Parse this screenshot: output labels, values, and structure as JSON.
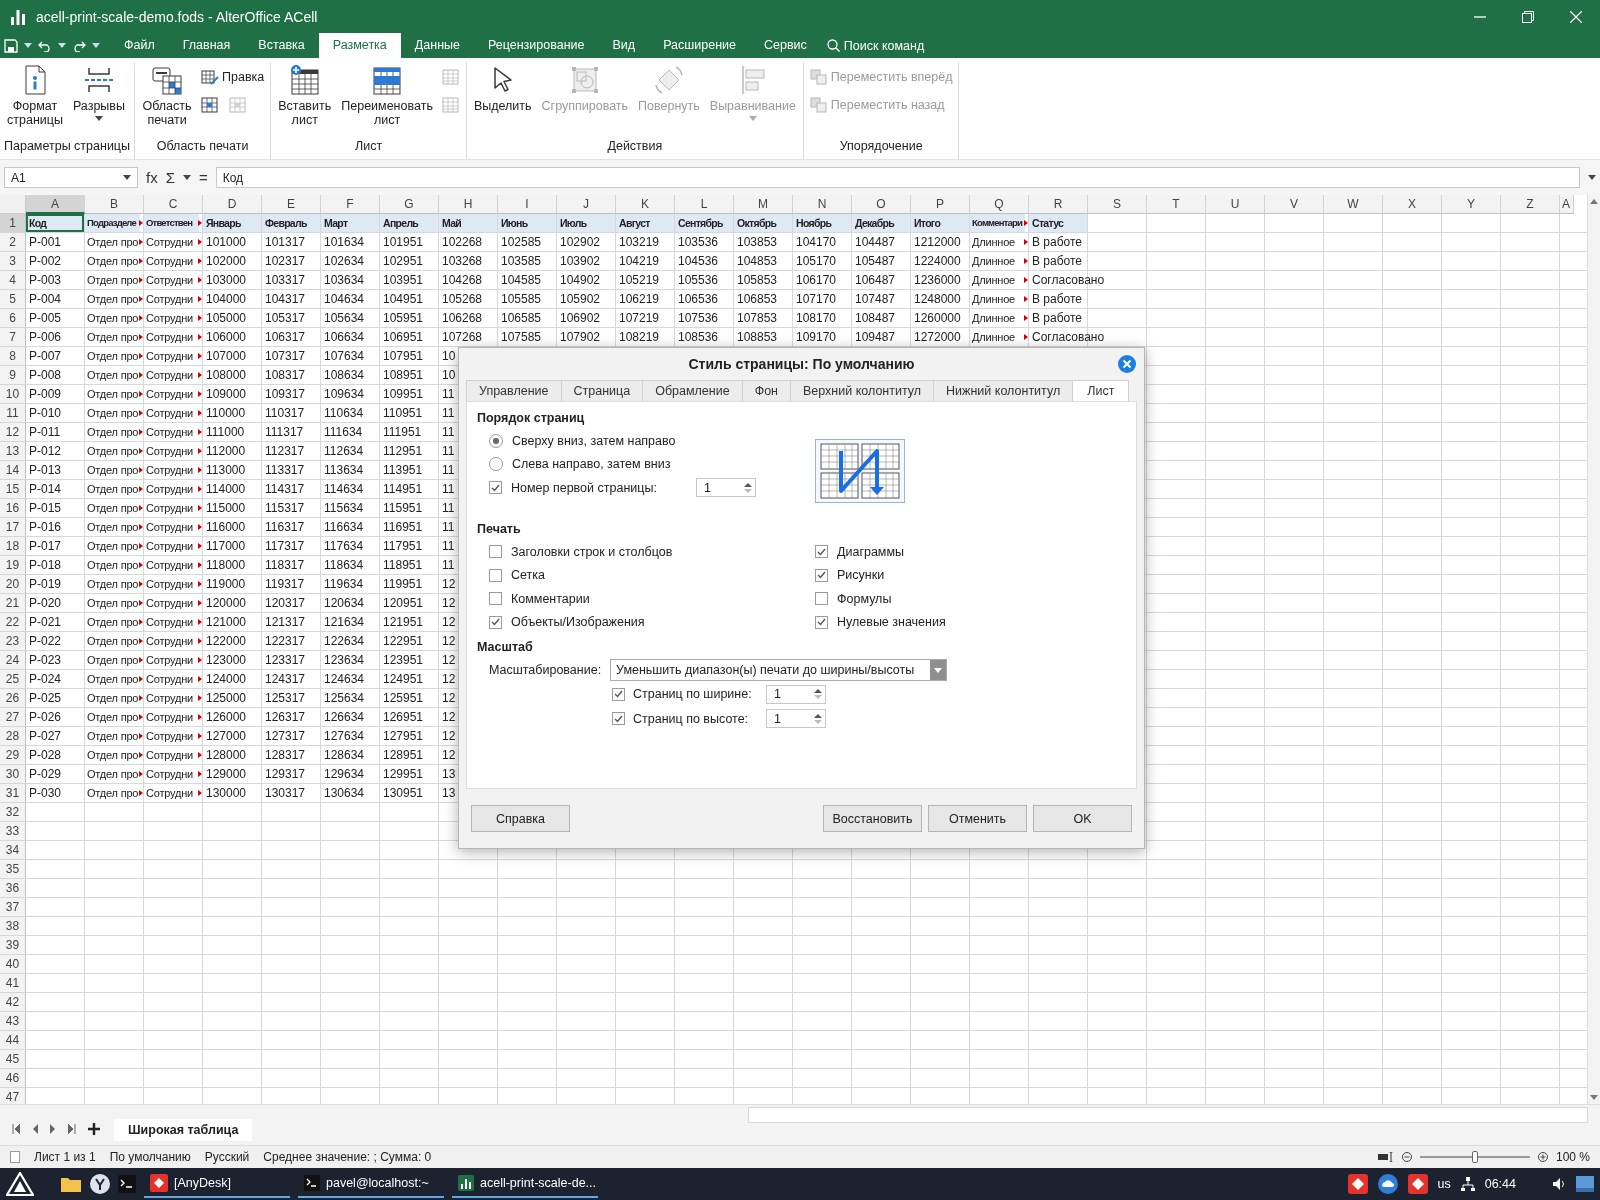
{
  "window": {
    "title": "acell-print-scale-demo.fods - AlterOffice ACell"
  },
  "menu": [
    {
      "label": "Файл",
      "selected": false
    },
    {
      "label": "Главная",
      "selected": false
    },
    {
      "label": "Вставка",
      "selected": false
    },
    {
      "label": "Разметка",
      "selected": true
    },
    {
      "label": "Данные",
      "selected": false
    },
    {
      "label": "Рецензирование",
      "selected": false
    },
    {
      "label": "Вид",
      "selected": false
    },
    {
      "label": "Расширение",
      "selected": false
    },
    {
      "label": "Сервис",
      "selected": false
    }
  ],
  "search": {
    "label": "Поиск команд"
  },
  "ribbon": {
    "groups": [
      {
        "label": "Параметры страницы",
        "buttons": [
          {
            "kind": "large",
            "label": "Формат\nстраницы",
            "disabled": false,
            "dropdown": false
          },
          {
            "kind": "large",
            "label": "Разрывы",
            "disabled": false,
            "dropdown": true
          }
        ]
      },
      {
        "label": "Область печати",
        "buttons": [
          {
            "kind": "large",
            "label": "Область\nпечати",
            "disabled": false,
            "dropdown": false
          }
        ],
        "rows": [
          [
            {
              "kind": "small",
              "label": "Правка",
              "disabled": false
            }
          ],
          [
            {
              "kind": "icon",
              "disabled": false
            },
            {
              "kind": "icon",
              "disabled": true
            }
          ]
        ]
      },
      {
        "label": "Лист",
        "buttons": [
          {
            "kind": "large",
            "label": "Вставить\nлист",
            "disabled": false,
            "dropdown": false
          },
          {
            "kind": "large",
            "label": "Переименовать\nлист",
            "disabled": false,
            "dropdown": false
          }
        ],
        "rows": [
          [
            {
              "kind": "icon",
              "disabled": true
            }
          ],
          [
            {
              "kind": "icon",
              "disabled": true
            }
          ]
        ]
      },
      {
        "label": "Действия",
        "buttons": [
          {
            "kind": "large",
            "label": "Выделить",
            "disabled": false,
            "dropdown": false
          },
          {
            "kind": "large",
            "label": "Сгруппировать",
            "disabled": true,
            "dropdown": false
          },
          {
            "kind": "large",
            "label": "Повернуть",
            "disabled": true,
            "dropdown": false
          },
          {
            "kind": "large",
            "label": "Выравнивание",
            "disabled": true,
            "dropdown": true
          }
        ]
      },
      {
        "label": "Упорядочение",
        "rows": [
          [
            {
              "kind": "small",
              "label": "Переместить вперёд",
              "disabled": true
            }
          ],
          [
            {
              "kind": "small",
              "label": "Переместить назад",
              "disabled": true
            }
          ]
        ]
      }
    ]
  },
  "formula_bar": {
    "cell_ref": "A1",
    "symbols": [
      "fx",
      "Σ",
      "="
    ],
    "content": "Код"
  },
  "sheet": {
    "columns": [
      {
        "letter": "A",
        "selected": true,
        "clipped": false
      },
      {
        "letter": "B",
        "selected": false,
        "clipped": true
      },
      {
        "letter": "C",
        "selected": false,
        "clipped": true
      },
      {
        "letter": "D",
        "selected": false,
        "clipped": false
      },
      {
        "letter": "E",
        "selected": false,
        "clipped": false
      },
      {
        "letter": "F",
        "selected": false,
        "clipped": false
      },
      {
        "letter": "G",
        "selected": false,
        "clipped": false
      },
      {
        "letter": "H",
        "selected": false,
        "clipped": false
      },
      {
        "letter": "I",
        "selected": false,
        "clipped": false
      },
      {
        "letter": "J",
        "selected": false,
        "clipped": false
      },
      {
        "letter": "K",
        "selected": false,
        "clipped": false
      },
      {
        "letter": "L",
        "selected": false,
        "clipped": false
      },
      {
        "letter": "M",
        "selected": false,
        "clipped": false
      },
      {
        "letter": "N",
        "selected": false,
        "clipped": false
      },
      {
        "letter": "O",
        "selected": false,
        "clipped": false
      },
      {
        "letter": "P",
        "selected": false,
        "clipped": false
      },
      {
        "letter": "Q",
        "selected": false,
        "clipped": true
      },
      {
        "letter": "R",
        "selected": false,
        "clipped": false
      },
      {
        "letter": "S",
        "selected": false,
        "clipped": false
      },
      {
        "letter": "T",
        "selected": false,
        "clipped": false
      },
      {
        "letter": "U",
        "selected": false,
        "clipped": false
      },
      {
        "letter": "V",
        "selected": false,
        "clipped": false
      },
      {
        "letter": "W",
        "selected": false,
        "clipped": false
      },
      {
        "letter": "X",
        "selected": false,
        "clipped": false
      },
      {
        "letter": "Y",
        "selected": false,
        "clipped": false
      },
      {
        "letter": "Z",
        "selected": false,
        "clipped": false
      },
      {
        "letter": "A",
        "selected": false,
        "clipped": false
      }
    ],
    "rows": [
      {
        "number": "1",
        "kind": "header",
        "selected": true,
        "cells": [
          "Код",
          "Подразделе",
          "Ответствен",
          "Январь",
          "Февраль",
          "Март",
          "Апрель",
          "Май",
          "Июнь",
          "Июль",
          "Август",
          "Сентябрь",
          "Октябрь",
          "Ноябрь",
          "Декабрь",
          "Итого",
          "Комментари",
          "Статус"
        ]
      },
      {
        "number": "2",
        "kind": "data",
        "selected": false,
        "cells": [
          "P-001",
          "Отдел про",
          "Сотрудни",
          "101000",
          "101317",
          "101634",
          "101951",
          "102268",
          "102585",
          "102902",
          "103219",
          "103536",
          "103853",
          "104170",
          "104487",
          "1212000",
          "Длинное",
          "В работе"
        ]
      },
      {
        "number": "3",
        "kind": "data",
        "selected": false,
        "cells": [
          "P-002",
          "Отдел про",
          "Сотрудни",
          "102000",
          "102317",
          "102634",
          "102951",
          "103268",
          "103585",
          "103902",
          "104219",
          "104536",
          "104853",
          "105170",
          "105487",
          "1224000",
          "Длинное",
          "В работе"
        ]
      },
      {
        "number": "4",
        "kind": "data",
        "selected": false,
        "cells": [
          "P-003",
          "Отдел про",
          "Сотрудни",
          "103000",
          "103317",
          "103634",
          "103951",
          "104268",
          "104585",
          "104902",
          "105219",
          "105536",
          "105853",
          "106170",
          "106487",
          "1236000",
          "Длинное",
          "Согласовано"
        ]
      },
      {
        "number": "5",
        "kind": "data",
        "selected": false,
        "cells": [
          "P-004",
          "Отдел про",
          "Сотрудни",
          "104000",
          "104317",
          "104634",
          "104951",
          "105268",
          "105585",
          "105902",
          "106219",
          "106536",
          "106853",
          "107170",
          "107487",
          "1248000",
          "Длинное",
          "В работе"
        ]
      },
      {
        "number": "6",
        "kind": "data",
        "selected": false,
        "cells": [
          "P-005",
          "Отдел про",
          "Сотрудни",
          "105000",
          "105317",
          "105634",
          "105951",
          "106268",
          "106585",
          "106902",
          "107219",
          "107536",
          "107853",
          "108170",
          "108487",
          "1260000",
          "Длинное",
          "В работе"
        ]
      },
      {
        "number": "7",
        "kind": "data",
        "selected": false,
        "cells": [
          "P-006",
          "Отдел про",
          "Сотрудни",
          "106000",
          "106317",
          "106634",
          "106951",
          "107268",
          "107585",
          "107902",
          "108219",
          "108536",
          "108853",
          "109170",
          "109487",
          "1272000",
          "Длинное",
          "Согласовано"
        ]
      },
      {
        "number": "8",
        "kind": "data",
        "selected": false,
        "cells": [
          "P-007",
          "Отдел про",
          "Сотрудни",
          "107000",
          "107317",
          "107634",
          "107951",
          "10"
        ]
      },
      {
        "number": "9",
        "kind": "data",
        "selected": false,
        "cells": [
          "P-008",
          "Отдел про",
          "Сотрудни",
          "108000",
          "108317",
          "108634",
          "108951",
          "10"
        ]
      },
      {
        "number": "10",
        "kind": "data",
        "selected": false,
        "cells": [
          "P-009",
          "Отдел про",
          "Сотрудни",
          "109000",
          "109317",
          "109634",
          "109951",
          "11"
        ]
      },
      {
        "number": "11",
        "kind": "data",
        "selected": false,
        "cells": [
          "P-010",
          "Отдел про",
          "Сотрудни",
          "110000",
          "110317",
          "110634",
          "110951",
          "11"
        ]
      },
      {
        "number": "12",
        "kind": "data",
        "selected": false,
        "cells": [
          "P-011",
          "Отдел про",
          "Сотрудни",
          "111000",
          "111317",
          "111634",
          "111951",
          "11"
        ]
      },
      {
        "number": "13",
        "kind": "data",
        "selected": false,
        "cells": [
          "P-012",
          "Отдел про",
          "Сотрудни",
          "112000",
          "112317",
          "112634",
          "112951",
          "11"
        ]
      },
      {
        "number": "14",
        "kind": "data",
        "selected": false,
        "cells": [
          "P-013",
          "Отдел про",
          "Сотрудни",
          "113000",
          "113317",
          "113634",
          "113951",
          "11"
        ]
      },
      {
        "number": "15",
        "kind": "data",
        "selected": false,
        "cells": [
          "P-014",
          "Отдел про",
          "Сотрудни",
          "114000",
          "114317",
          "114634",
          "114951",
          "11"
        ]
      },
      {
        "number": "16",
        "kind": "data",
        "selected": false,
        "cells": [
          "P-015",
          "Отдел про",
          "Сотрудни",
          "115000",
          "115317",
          "115634",
          "115951",
          "11"
        ]
      },
      {
        "number": "17",
        "kind": "data",
        "selected": false,
        "cells": [
          "P-016",
          "Отдел про",
          "Сотрудни",
          "116000",
          "116317",
          "116634",
          "116951",
          "11"
        ]
      },
      {
        "number": "18",
        "kind": "data",
        "selected": false,
        "cells": [
          "P-017",
          "Отдел про",
          "Сотрудни",
          "117000",
          "117317",
          "117634",
          "117951",
          "11"
        ]
      },
      {
        "number": "19",
        "kind": "data",
        "selected": false,
        "cells": [
          "P-018",
          "Отдел про",
          "Сотрудни",
          "118000",
          "118317",
          "118634",
          "118951",
          "11"
        ]
      },
      {
        "number": "20",
        "kind": "data",
        "selected": false,
        "cells": [
          "P-019",
          "Отдел про",
          "Сотрудни",
          "119000",
          "119317",
          "119634",
          "119951",
          "12"
        ]
      },
      {
        "number": "21",
        "kind": "data",
        "selected": false,
        "cells": [
          "P-020",
          "Отдел про",
          "Сотрудни",
          "120000",
          "120317",
          "120634",
          "120951",
          "12"
        ]
      },
      {
        "number": "22",
        "kind": "data",
        "selected": false,
        "cells": [
          "P-021",
          "Отдел про",
          "Сотрудни",
          "121000",
          "121317",
          "121634",
          "121951",
          "12"
        ]
      },
      {
        "number": "23",
        "kind": "data",
        "selected": false,
        "cells": [
          "P-022",
          "Отдел про",
          "Сотрудни",
          "122000",
          "122317",
          "122634",
          "122951",
          "12"
        ]
      },
      {
        "number": "24",
        "kind": "data",
        "selected": false,
        "cells": [
          "P-023",
          "Отдел про",
          "Сотрудни",
          "123000",
          "123317",
          "123634",
          "123951",
          "12"
        ]
      },
      {
        "number": "25",
        "kind": "data",
        "selected": false,
        "cells": [
          "P-024",
          "Отдел про",
          "Сотрудни",
          "124000",
          "124317",
          "124634",
          "124951",
          "12"
        ]
      },
      {
        "number": "26",
        "kind": "data",
        "selected": false,
        "cells": [
          "P-025",
          "Отдел про",
          "Сотрудни",
          "125000",
          "125317",
          "125634",
          "125951",
          "12"
        ]
      },
      {
        "number": "27",
        "kind": "data",
        "selected": false,
        "cells": [
          "P-026",
          "Отдел про",
          "Сотрудни",
          "126000",
          "126317",
          "126634",
          "126951",
          "12"
        ]
      },
      {
        "number": "28",
        "kind": "data",
        "selected": false,
        "cells": [
          "P-027",
          "Отдел про",
          "Сотрудни",
          "127000",
          "127317",
          "127634",
          "127951",
          "12"
        ]
      },
      {
        "number": "29",
        "kind": "data",
        "selected": false,
        "cells": [
          "P-028",
          "Отдел про",
          "Сотрудни",
          "128000",
          "128317",
          "128634",
          "128951",
          "12"
        ]
      },
      {
        "number": "30",
        "kind": "data",
        "selected": false,
        "cells": [
          "P-029",
          "Отдел про",
          "Сотрудни",
          "129000",
          "129317",
          "129634",
          "129951",
          "13"
        ]
      },
      {
        "number": "31",
        "kind": "data",
        "selected": false,
        "cells": [
          "P-030",
          "Отдел про",
          "Сотрудни",
          "130000",
          "130317",
          "130634",
          "130951",
          "13"
        ]
      },
      {
        "number": "32",
        "kind": "data",
        "selected": false
      },
      {
        "number": "33",
        "kind": "data",
        "selected": false
      },
      {
        "number": "34",
        "kind": "data",
        "selected": false
      },
      {
        "number": "35",
        "kind": "data",
        "selected": false
      },
      {
        "number": "36",
        "kind": "data",
        "selected": false
      },
      {
        "number": "37",
        "kind": "data",
        "selected": false
      },
      {
        "number": "38",
        "kind": "data",
        "selected": false
      },
      {
        "number": "39",
        "kind": "data",
        "selected": false
      },
      {
        "number": "40",
        "kind": "data",
        "selected": false
      },
      {
        "number": "41",
        "kind": "data",
        "selected": false
      },
      {
        "number": "42",
        "kind": "data",
        "selected": false
      },
      {
        "number": "43",
        "kind": "data",
        "selected": false
      },
      {
        "number": "44",
        "kind": "data",
        "selected": false
      },
      {
        "number": "45",
        "kind": "data",
        "selected": false
      },
      {
        "number": "46",
        "kind": "data",
        "selected": false
      },
      {
        "number": "47",
        "kind": "data",
        "selected": false
      }
    ]
  },
  "sheet_tabs": [
    {
      "label": "Широкая таблица",
      "selected": true
    }
  ],
  "status_bar": {
    "items": [
      "Лист 1 из 1",
      "По умолчанию",
      "Русский",
      "Среднее значение: ; Сумма: 0"
    ],
    "zoom": {
      "level": 0.5,
      "reading": "100 %"
    }
  },
  "taskbar": {
    "tasks": [
      "[AnyDesk]",
      "pavel@localhost:~",
      "acell-print-scale-de..."
    ],
    "keyboard_layout": "us",
    "clock": "06:44"
  },
  "dialog": {
    "title": "Стиль страницы: По умолчанию",
    "tabs": [
      {
        "label": "Управление",
        "selected": false
      },
      {
        "label": "Страница",
        "selected": false
      },
      {
        "label": "Обрамление",
        "selected": false
      },
      {
        "label": "Фон",
        "selected": false
      },
      {
        "label": "Верхний колонтитул",
        "selected": false
      },
      {
        "label": "Нижний колонтитул",
        "selected": false
      },
      {
        "label": "Лист",
        "selected": true
      }
    ],
    "page_order": {
      "heading": "Порядок страниц",
      "options": [
        {
          "label": "Сверху вниз, затем направо",
          "selected": true
        },
        {
          "label": "Слева направо, затем вниз",
          "selected": false
        }
      ],
      "first_page_number": {
        "label": "Номер первой страницы:",
        "checked": true,
        "value": "1"
      }
    },
    "print": {
      "heading": "Печать",
      "options": [
        {
          "label": "Заголовки строк и столбцов",
          "checked": false
        },
        {
          "label": "Сетка",
          "checked": false
        },
        {
          "label": "Комментарии",
          "checked": false
        },
        {
          "label": "Объекты/Изображения",
          "checked": true
        },
        {
          "label": "Диаграммы",
          "checked": true
        },
        {
          "label": "Рисунки",
          "checked": true
        },
        {
          "label": "Формулы",
          "checked": false
        },
        {
          "label": "Нулевые значения",
          "checked": true
        }
      ]
    },
    "scale": {
      "heading": "Масштаб",
      "mode_label": "Масштабирование:",
      "mode_value": "Уменьшить диапазон(ы) печати до ширины/высоты",
      "fields": [
        {
          "label": "Страниц по ширине:",
          "checked": true,
          "value": "1"
        },
        {
          "label": "Страниц по высоте:",
          "checked": true,
          "value": "1"
        }
      ]
    },
    "buttons": [
      "Справка",
      "Восстановить",
      "Отменить",
      "OK"
    ]
  }
}
